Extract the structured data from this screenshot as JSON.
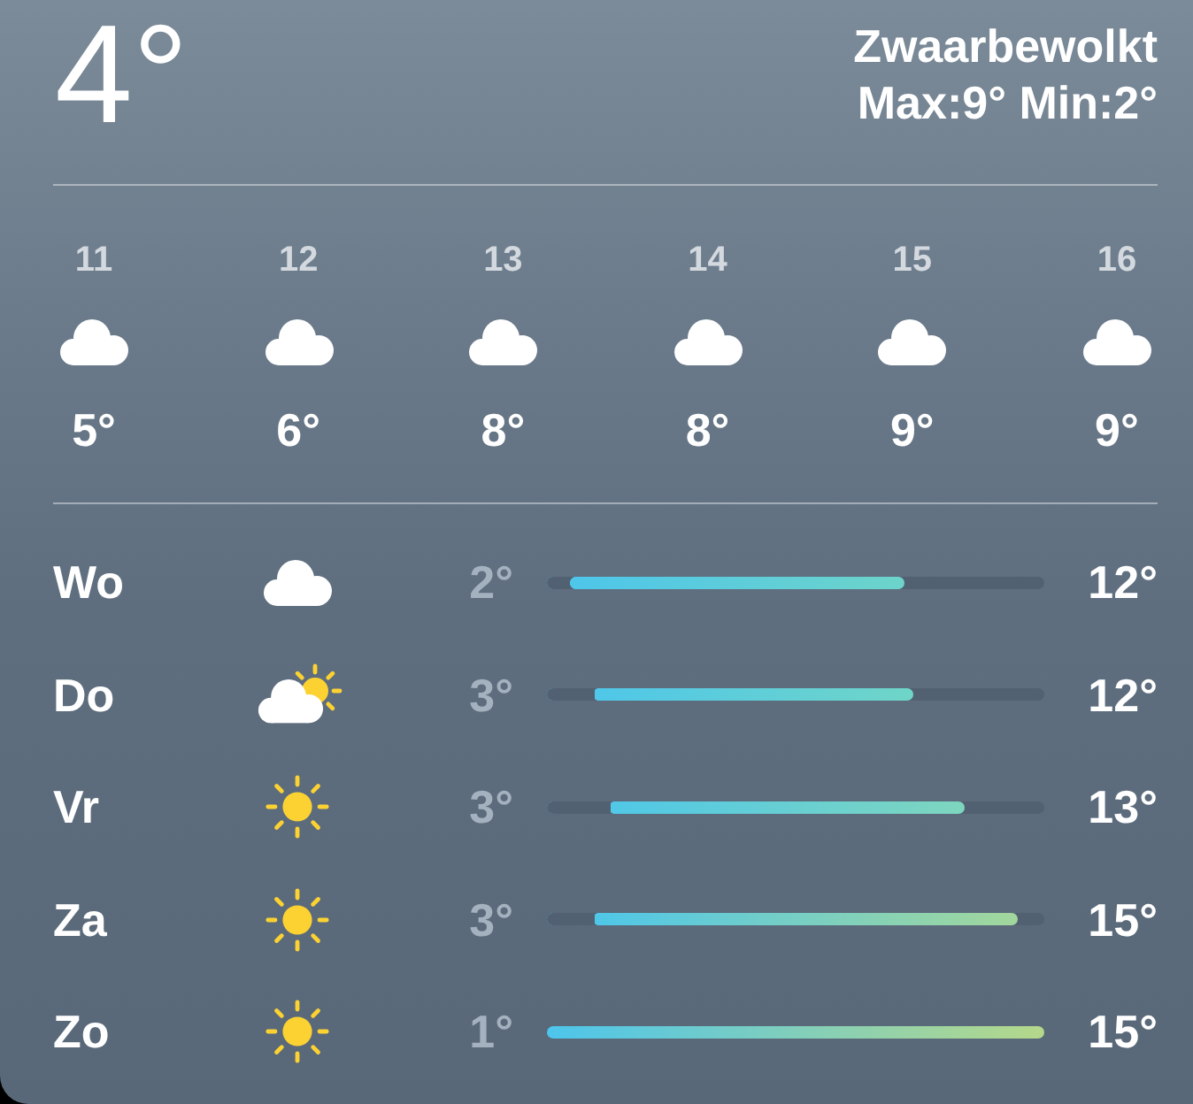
{
  "current": {
    "temperature": "4°",
    "condition": "Zwaarbewolkt",
    "high_low": "Max:9° Min:2°"
  },
  "hourly": [
    {
      "hour": "11",
      "kind": "cloudy",
      "temperature": "5°"
    },
    {
      "hour": "12",
      "kind": "cloudy",
      "temperature": "6°"
    },
    {
      "hour": "13",
      "kind": "cloudy",
      "temperature": "8°"
    },
    {
      "hour": "14",
      "kind": "cloudy",
      "temperature": "8°"
    },
    {
      "hour": "15",
      "kind": "cloudy",
      "temperature": "9°"
    },
    {
      "hour": "16",
      "kind": "cloudy",
      "temperature": "9°"
    }
  ],
  "daily": [
    {
      "day": "Wo",
      "kind": "cloudy",
      "low": "2°",
      "high": "12°",
      "bar": {
        "start": {
          "level": 0.046
        },
        "end": {
          "level": 0.72
        }
      }
    },
    {
      "day": "Do",
      "kind": "partlycloudy",
      "low": "3°",
      "high": "12°",
      "bar": {
        "start": {
          "level": 0.093
        },
        "end": {
          "level": 0.737
        }
      }
    },
    {
      "day": "Vr",
      "kind": "sunny",
      "low": "3°",
      "high": "13°",
      "bar": {
        "start": {
          "level": 0.125
        },
        "end": {
          "level": 0.84
        }
      }
    },
    {
      "day": "Za",
      "kind": "sunny",
      "low": "3°",
      "high": "15°",
      "bar": {
        "start": {
          "level": 0.093
        },
        "end": {
          "level": 0.947
        }
      }
    },
    {
      "day": "Zo",
      "kind": "sunny",
      "low": "1°",
      "high": "15°",
      "bar": {
        "end": {
          "level": 1
        }
      }
    }
  ]
}
